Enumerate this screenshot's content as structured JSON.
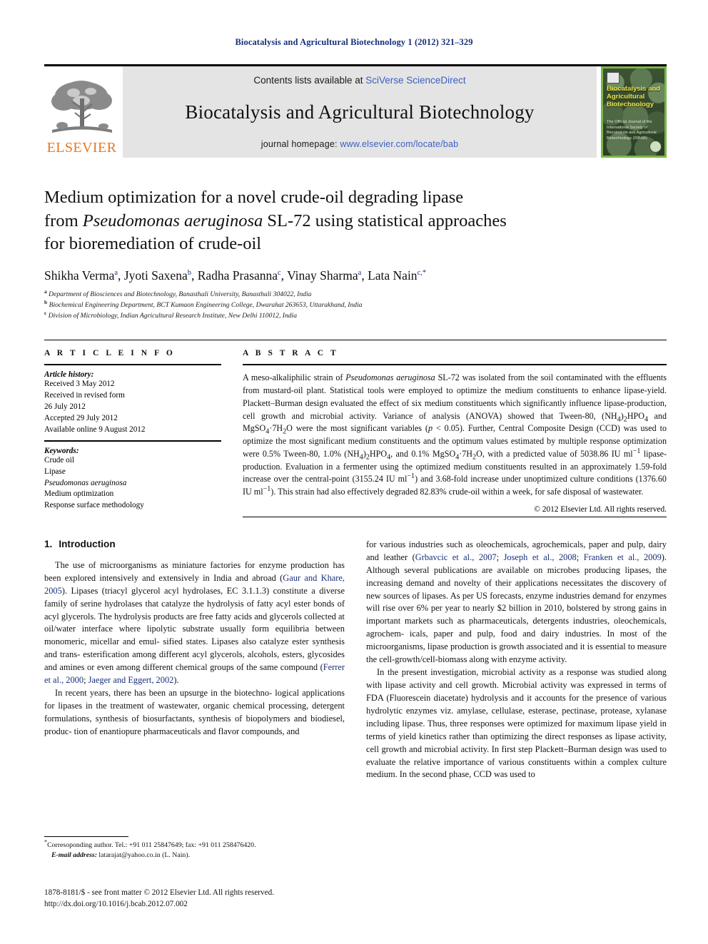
{
  "running_head": "Biocatalysis and Agricultural Biotechnology 1 (2012) 321–329",
  "masthead": {
    "publisher": "ELSEVIER",
    "contents_prefix": "Contents lists available at ",
    "contents_link": "SciVerse ScienceDirect",
    "journal_name": "Biocatalysis and Agricultural Biotechnology",
    "homepage_prefix": "journal homepage: ",
    "homepage_link": "www.elsevier.com/locate/bab",
    "cover": {
      "title": "Biocatalysis and Agricultural Biotechnology",
      "subtitle": "The Official Journal of the International Society of Biocatalysis and Agricultural Biotechnology (ISBAB)"
    },
    "colors": {
      "band_bg": "#e4e4e4",
      "link_blue": "#3b5fc0",
      "elsevier_orange": "#e87722",
      "cover_green": "#7ab648"
    }
  },
  "article": {
    "title_line1": "Medium optimization for a novel crude-oil degrading lipase",
    "title_line2_pre": "from ",
    "title_line2_italic": "Pseudomonas aeruginosa",
    "title_line2_post": " SL-72 using statistical approaches",
    "title_line3": "for bioremediation of crude-oil",
    "authors": [
      {
        "name": "Shikha Verma",
        "marks": "a"
      },
      {
        "name": "Jyoti Saxena",
        "marks": "b"
      },
      {
        "name": "Radha Prasanna",
        "marks": "c"
      },
      {
        "name": "Vinay Sharma",
        "marks": "a"
      },
      {
        "name": "Lata Nain",
        "marks": "c,*"
      }
    ],
    "affiliations": [
      {
        "mark": "a",
        "text": "Department of Biosciences and Biotechnology, Banasthali University, Banasthali 304022, India"
      },
      {
        "mark": "b",
        "text": "Biochemical Engineering Department, BCT Kumaon Engineering College, Dwarahat 263653, Uttarakhand, India"
      },
      {
        "mark": "c",
        "text": "Division of Microbiology, Indian Agricultural Research Institute, New Delhi 110012, India"
      }
    ]
  },
  "article_info": {
    "heading": "A R T I C L E  I N F O",
    "history_label": "Article history:",
    "history": [
      "Received 3 May 2012",
      "Received in revised form",
      "26 July 2012",
      "Accepted 29 July 2012",
      "Available online 9 August 2012"
    ],
    "keywords_label": "Keywords:",
    "keywords": [
      {
        "text": "Crude oil",
        "italic": false
      },
      {
        "text": "Lipase",
        "italic": false
      },
      {
        "text": "Pseudomonas aeruginosa",
        "italic": true
      },
      {
        "text": "Medium optimization",
        "italic": false
      },
      {
        "text": "Response surface methodology",
        "italic": false
      }
    ]
  },
  "abstract": {
    "heading": "A B S T R A C T",
    "copyright": "© 2012 Elsevier Ltd. All rights reserved."
  },
  "introduction": {
    "number": "1.",
    "title": "Introduction"
  },
  "footnote": {
    "corresponding": "Corresoponding author. Tel.: +91 011 25847649; fax: +91 011 258476420.",
    "email_label": "E-mail address:",
    "email": "latarajat@yahoo.co.in (L. Nain)."
  },
  "footer": {
    "issn_line": "1878-8181/$ - see front matter © 2012 Elsevier Ltd. All rights reserved.",
    "doi_line": "http://dx.doi.org/10.1016/j.bcab.2012.07.002"
  }
}
